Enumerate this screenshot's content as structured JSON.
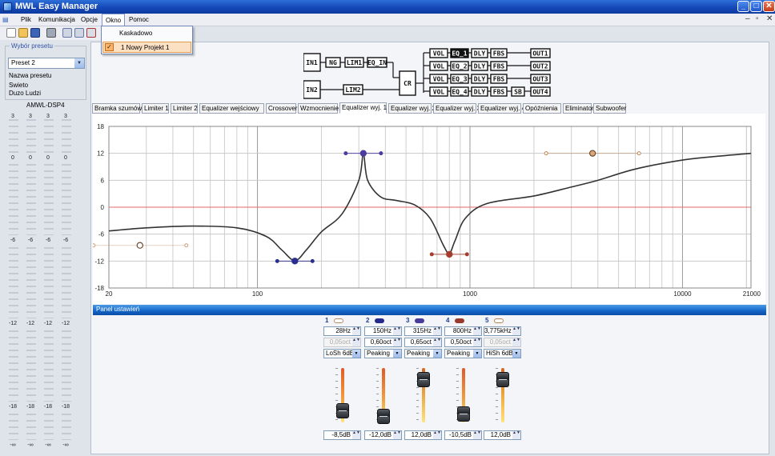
{
  "window": {
    "title": "MWL Easy Manager",
    "controls": [
      "_",
      "□",
      "✕"
    ],
    "mdi_controls": [
      "–",
      "▫",
      "✕"
    ]
  },
  "menu": [
    "Plik",
    "Komunikacja",
    "Opcje",
    "Okno",
    "Pomoc"
  ],
  "dropdown": {
    "items": [
      "Kaskadowo",
      "1 Nowy Projekt 1"
    ]
  },
  "preset": {
    "group_title": "Wybór presetu",
    "selected": "Preset 2",
    "name_label": "Nazwa presetu",
    "name_line1": "Swieto",
    "name_line2": "Duzo Ludzi"
  },
  "meters": {
    "title": "AMWL-DSP4",
    "levels": [
      "3",
      "0",
      "-6",
      "-12",
      "-18",
      "-∞"
    ]
  },
  "diagram": {
    "in1": "IN1",
    "in2": "IN2",
    "ng": "NG",
    "lim1": "LIM1",
    "lim2": "LIM2",
    "eq_in": "EQ_IN",
    "cr": "CR",
    "vol": "VOL",
    "dly": "DLY",
    "fbs": "FBS",
    "sb": "SB",
    "eqs": [
      "EQ_1",
      "EQ_2",
      "EQ_3",
      "EQ_4"
    ],
    "outs": [
      "OUT1",
      "OUT2",
      "OUT3",
      "OUT4"
    ]
  },
  "tabs": [
    "Bramka szumów",
    "Limiter 1",
    "Limiter 2",
    "Equalizer wejściowy",
    "Crossover",
    "Wzmocnienie",
    "Equalizer wyj. 1",
    "Equalizer wyj. 2",
    "Equalizer wyj. 3",
    "Equalizer wyj. 4",
    "Opóźnienia",
    "Eliminator",
    "Subwoofer"
  ],
  "active_tab": "Equalizer wyj. 1",
  "chart_data": {
    "type": "line",
    "x_scale": "log",
    "xlim": [
      20,
      21000
    ],
    "ylim": [
      -18,
      18
    ],
    "y_ticks": [
      "18",
      "12",
      "6",
      "0",
      "-6",
      "-12",
      "-18"
    ],
    "x_ticks": [
      "20",
      "100",
      "1000",
      "10000",
      "21000"
    ],
    "grid": true,
    "series": [
      {
        "x": [
          20,
          30,
          50,
          80,
          110,
          130,
          150,
          170,
          200,
          250,
          300,
          315,
          330,
          380,
          450,
          550,
          650,
          750,
          800,
          850,
          950,
          1200,
          2000,
          3000,
          4000,
          6000,
          10000,
          15000,
          21000
        ],
        "y": [
          -5.3,
          -4.6,
          -4.2,
          -4.6,
          -6.5,
          -9.5,
          -11.9,
          -9.5,
          -5.5,
          -1.5,
          6.0,
          11.8,
          6.0,
          2.3,
          1.5,
          0.5,
          -2.5,
          -8.5,
          -10.3,
          -7.5,
          -2.5,
          0.8,
          2.5,
          4.5,
          6.0,
          8.5,
          10.5,
          11.4,
          12.0
        ]
      }
    ],
    "bands": [
      {
        "freq": 28,
        "gain": -8.5,
        "color": "#c8a07a"
      },
      {
        "freq": 150,
        "gain": -12.0,
        "color": "#2a2f8f"
      },
      {
        "freq": 315,
        "gain": 12.0,
        "color": "#4b3c9e"
      },
      {
        "freq": 800,
        "gain": -10.5,
        "color": "#a63c2e"
      },
      {
        "freq": 3775,
        "gain": 12.0,
        "color": "#c18450"
      }
    ]
  },
  "panel": {
    "title": "Panel ustawień"
  },
  "bands": [
    {
      "num": "1",
      "freq": "28Hz",
      "bw": "0,05oct",
      "bw_disabled": true,
      "type": "LoSh 6dB",
      "gain": "-8,5dB",
      "level": -8.5,
      "color": "#b88a63"
    },
    {
      "num": "2",
      "freq": "150Hz",
      "bw": "0,60oct",
      "bw_disabled": false,
      "type": "Peaking",
      "gain": "-12,0dB",
      "level": -12.0,
      "color": "#262a8a"
    },
    {
      "num": "3",
      "freq": "315Hz",
      "bw": "0,65oct",
      "bw_disabled": false,
      "type": "Peaking",
      "gain": "12,0dB",
      "level": 12.0,
      "color": "#4a3a9a"
    },
    {
      "num": "4",
      "freq": "800Hz",
      "bw": "0,50oct",
      "bw_disabled": false,
      "type": "Peaking",
      "gain": "-10,5dB",
      "level": -10.5,
      "color": "#9a3a2c"
    },
    {
      "num": "5",
      "freq": "3,775kHz",
      "bw": "0,05oct",
      "bw_disabled": true,
      "type": "HiSh 6dB",
      "gain": "12,0dB",
      "level": 12.0,
      "color": "#b8824e"
    }
  ]
}
